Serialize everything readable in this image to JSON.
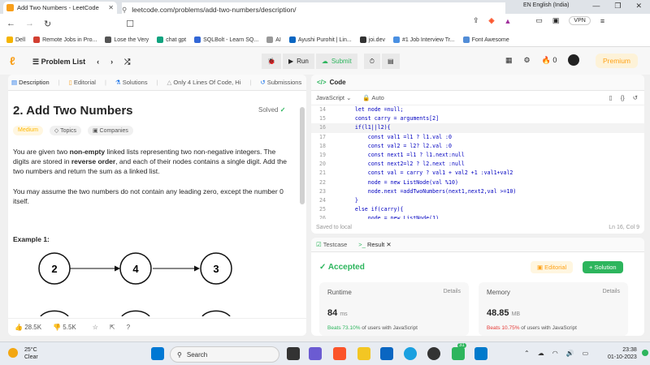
{
  "browser": {
    "tab_title": "Add Two Numbers - LeetCode",
    "url": "leetcode.com/problems/add-two-numbers/description/",
    "language_indicator": "EN English (India)",
    "vpn_label": "VPN",
    "brave_badge": "4"
  },
  "bookmarks": [
    {
      "label": "Dell",
      "color": "#f5b400"
    },
    {
      "label": "Remote Jobs in Pro...",
      "color": "#d23f31"
    },
    {
      "label": "Lose the Very",
      "color": "#555555"
    },
    {
      "label": "chat gpt",
      "color": "#10a37f"
    },
    {
      "label": "SQLBolt - Learn SQ...",
      "color": "#3367d6"
    },
    {
      "label": "AI",
      "color": "#999999"
    },
    {
      "label": "Ayushi Purohit | Lin...",
      "color": "#0a66c2"
    },
    {
      "label": "joi.dev",
      "color": "#333333"
    },
    {
      "label": "#1 Job Interview Tr...",
      "color": "#4a90e2"
    },
    {
      "label": "Font Awesome",
      "color": "#528dd7"
    }
  ],
  "lcnav": {
    "problem_list": "Problem List",
    "run": "Run",
    "submit": "Submit",
    "streak": "0",
    "premium": "Premium"
  },
  "left": {
    "tabs": [
      "Description",
      "Editorial",
      "Solutions",
      "Only 4 Lines Of Code, Hi",
      "Submissions"
    ],
    "title": "2. Add Two Numbers",
    "solved": "Solved",
    "pills": [
      "Medium",
      "Topics",
      "Companies"
    ],
    "desc_parts": {
      "a": "You are given two ",
      "b": "non-empty",
      "c": " linked lists representing two non-negative integers. The digits are stored in ",
      "d": "reverse order",
      "e": ", and each of their nodes contains a single digit. Add the two numbers and return the sum as a linked list."
    },
    "desc2": "You may assume the two numbers do not contain any leading zero, except the number 0 itself.",
    "example_label": "Example 1:",
    "nodes": [
      "2",
      "4",
      "3"
    ],
    "likes": "28.5K",
    "dislikes": "5.5K"
  },
  "code": {
    "header": "Code",
    "language": "JavaScript",
    "auto": "Auto",
    "lines": [
      {
        "n": "14",
        "t": "    let node =null;"
      },
      {
        "n": "15",
        "t": "    const carry = arguments[2]"
      },
      {
        "n": "16",
        "t": "    if(l1||l2){"
      },
      {
        "n": "17",
        "t": "        const val1 =l1 ? l1.val :0"
      },
      {
        "n": "18",
        "t": "        const val2 = l2? l2.val :0"
      },
      {
        "n": "19",
        "t": "        const next1 =l1 ? l1.next:null"
      },
      {
        "n": "20",
        "t": "        const next2=l2 ? l2.next :null"
      },
      {
        "n": "21",
        "t": "        const val = carry ? val1 + val2 +1 :val1+val2"
      },
      {
        "n": "22",
        "t": "        node = new ListNode(val %10)"
      },
      {
        "n": "23",
        "t": "        node.next =addTwoNumbers(next1,next2,val >=10)"
      },
      {
        "n": "24",
        "t": "    }"
      },
      {
        "n": "25",
        "t": "    else if(carry){"
      },
      {
        "n": "26",
        "t": "        node = new ListNode(1)"
      }
    ],
    "saved": "Saved to local",
    "position": "Ln 16, Col 9"
  },
  "result": {
    "tabs": [
      "Testcase",
      "Result"
    ],
    "status": "Accepted",
    "editorial": "Editorial",
    "solution": "Solution",
    "runtime_label": "Runtime",
    "runtime_value": "84",
    "runtime_unit": "ms",
    "runtime_beats": "Beats 73.10%",
    "memory_label": "Memory",
    "memory_value": "48.85",
    "memory_unit": "MB",
    "memory_beats": "Beats 10.75%",
    "beats_suffix": "of users with JavaScript",
    "details": "Details"
  },
  "taskbar": {
    "temperature": "25°C",
    "weather": "Clear",
    "search": "Search",
    "time": "23:38",
    "date": "01-10-2023",
    "badge": "31"
  }
}
